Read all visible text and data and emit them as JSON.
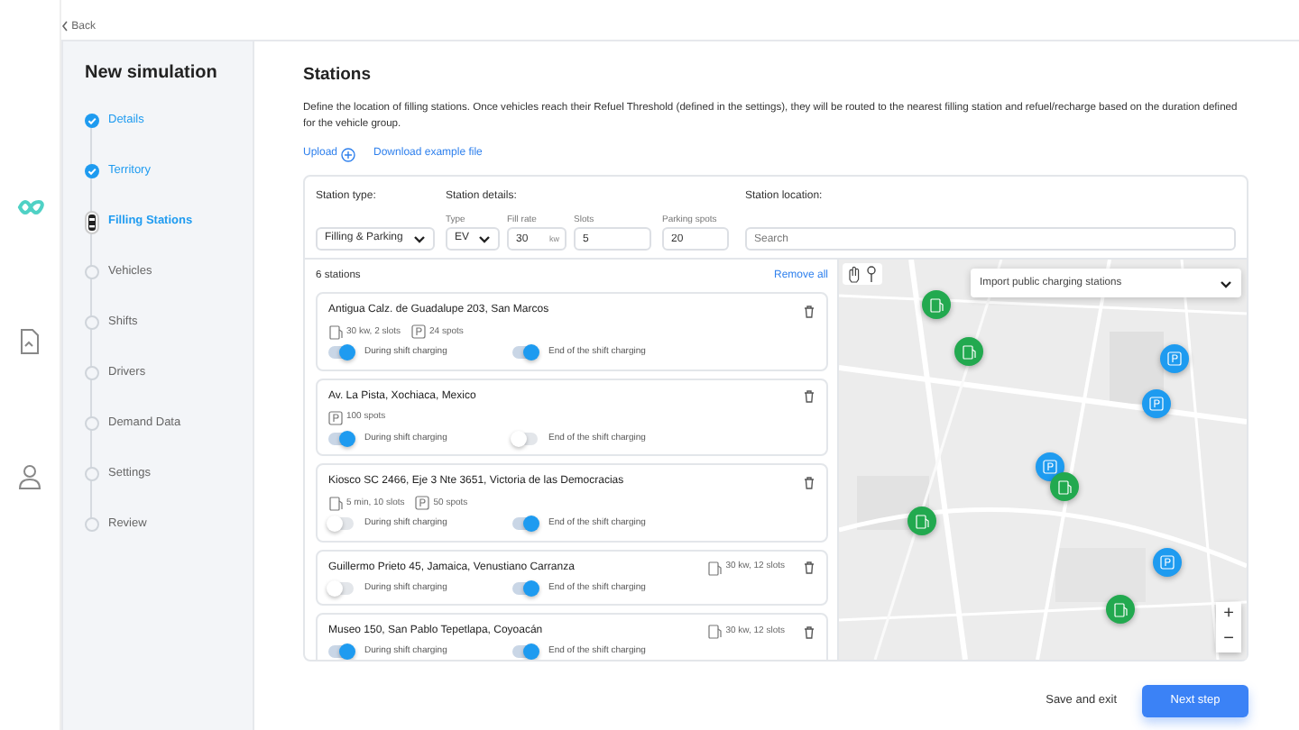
{
  "back": "Back",
  "rail": [
    {
      "kind": "infinity",
      "selected": true
    },
    {
      "kind": "document",
      "selected": false
    },
    {
      "kind": "user",
      "selected": false
    }
  ],
  "wizard": {
    "title": "New simulation",
    "steps": [
      {
        "label": "Details",
        "done": true,
        "selected": false
      },
      {
        "label": "Territory",
        "done": true,
        "selected": false
      },
      {
        "label": "Filling Stations",
        "done": false,
        "selected": true
      },
      {
        "label": "Vehicles",
        "done": false,
        "selected": false
      },
      {
        "label": "Shifts",
        "done": false,
        "selected": false
      },
      {
        "label": "Drivers",
        "done": false,
        "selected": false
      },
      {
        "label": "Demand Data",
        "done": false,
        "selected": false
      },
      {
        "label": "Settings",
        "done": false,
        "selected": false
      },
      {
        "label": "Review",
        "done": false,
        "selected": false
      }
    ]
  },
  "page": {
    "title": "Stations",
    "description": "Define the location of filling stations. Once vehicles reach their Refuel Threshold (defined in the settings), they will be routed to the nearest filling station and refuel/recharge based on the duration defined for the vehicle group.",
    "upload": "Upload",
    "download": "Download example file"
  },
  "form": {
    "station_type_label": "Station type:",
    "station_type": "Filling & Parking",
    "details_label": "Station details:",
    "type_label": "Type",
    "type": "EV",
    "fill_rate_label": "Fill rate",
    "fill_rate": "30",
    "fill_rate_unit": "kw",
    "slots_label": "Slots",
    "slots": "5",
    "parking_label": "Parking spots",
    "parking": "20",
    "location_label": "Station location:",
    "location_placeholder": "Search"
  },
  "list": {
    "count": "6 stations",
    "remove_all": "Remove all",
    "stations": [
      {
        "address": "Antigua Calz. de Guadalupe 203, San Marcos",
        "fuel": "30 kw, 2 slots",
        "parking": "24 spots",
        "during": {
          "label": "During shift charging",
          "on": true
        },
        "end": {
          "label": "End of the shift charging",
          "on": true
        }
      },
      {
        "address": "Av. La Pista, Xochiaca, Mexico",
        "parking": "100 spots",
        "during": {
          "label": "During shift charging",
          "on": true
        },
        "end": {
          "label": "End of the shift charging",
          "on": false
        }
      },
      {
        "address": "Kiosco SC 2466, Eje 3 Nte 3651, Victoria de las Democracias",
        "fuel": "5 min, 10 slots",
        "parking": "50 spots",
        "during": {
          "label": "During shift charging",
          "on": false
        },
        "end": {
          "label": "End of the shift charging",
          "on": true
        }
      },
      {
        "address": "Guillermo Prieto 45, Jamaica, Venustiano Carranza",
        "fuel": "30 kw, 12 slots",
        "during": {
          "label": "During shift charging",
          "on": false
        },
        "end": {
          "label": "End of the shift charging",
          "on": true
        }
      },
      {
        "address": "Museo 150, San Pablo Tepetlapa, Coyoacán",
        "fuel": "30 kw, 12 slots",
        "during": {
          "label": "During shift charging",
          "on": true
        },
        "end": {
          "label": "End of the shift charging",
          "on": true
        }
      }
    ]
  },
  "map": {
    "import_label": "Import public charging stations",
    "markers": [
      {
        "kind": "fuel"
      },
      {
        "kind": "fuel"
      },
      {
        "kind": "parking"
      },
      {
        "kind": "parking"
      },
      {
        "kind": "parking"
      },
      {
        "kind": "fuel"
      },
      {
        "kind": "fuel"
      },
      {
        "kind": "parking"
      },
      {
        "kind": "fuel"
      }
    ],
    "zoom_in": "+",
    "zoom_out": "−"
  },
  "footer": {
    "save": "Save and exit",
    "next": "Next step"
  }
}
